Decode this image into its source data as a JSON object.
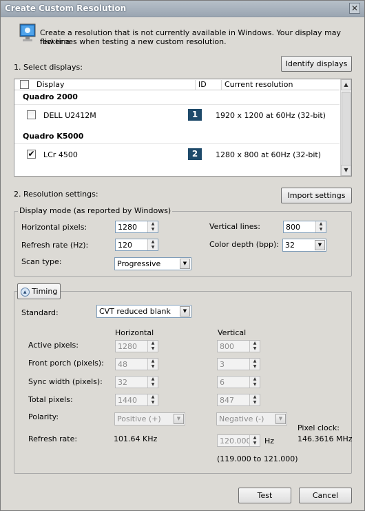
{
  "window": {
    "title": "Create Custom Resolution",
    "close_glyph": "✕"
  },
  "intro": {
    "icon": "monitor-icon",
    "text_line1": "Create a resolution that is not currently available in Windows. Your display may flicker a",
    "text_line2": "few times when testing a new custom resolution."
  },
  "select_displays": {
    "heading": "1. Select displays:",
    "identify_button": "Identify displays",
    "columns": {
      "display": "Display",
      "id": "ID",
      "resolution": "Current resolution"
    },
    "groups": [
      {
        "name": "Quadro 2000",
        "display": "DELL U2412M",
        "checked": false,
        "id": "1",
        "resolution": "1920 x 1200 at 60Hz (32-bit)"
      },
      {
        "name": "Quadro K5000",
        "display": "LCr 4500",
        "checked": true,
        "id": "2",
        "resolution": "1280 x 800 at 60Hz (32-bit)"
      }
    ],
    "scroll_up_glyph": "▲",
    "scroll_down_glyph": "▼",
    "check_glyph": "✔"
  },
  "resolution_settings": {
    "heading": "2. Resolution settings:",
    "import_button": "Import settings",
    "display_mode": {
      "legend": "Display mode (as reported by Windows)",
      "horizontal_pixels": {
        "label": "Horizontal pixels:",
        "value": "1280"
      },
      "refresh_rate": {
        "label": "Refresh rate (Hz):",
        "value": "120"
      },
      "scan_type": {
        "label": "Scan type:",
        "value": "Progressive"
      },
      "vertical_lines": {
        "label": "Vertical lines:",
        "value": "800"
      },
      "color_depth": {
        "label": "Color depth (bpp):",
        "value": "32"
      }
    },
    "timing": {
      "toggle_label": "Timing",
      "toggle_glyph": "▲",
      "standard": {
        "label": "Standard:",
        "value": "CVT reduced blank"
      },
      "col_horizontal": "Horizontal",
      "col_vertical": "Vertical",
      "rows": [
        {
          "label": "Active pixels:",
          "h": "1280",
          "v": "800"
        },
        {
          "label": "Front porch (pixels):",
          "h": "48",
          "v": "3"
        },
        {
          "label": "Sync width (pixels):",
          "h": "32",
          "v": "6"
        },
        {
          "label": "Total pixels:",
          "h": "1440",
          "v": "847"
        }
      ],
      "polarity": {
        "label": "Polarity:",
        "h": "Positive (+)",
        "v": "Negative (-)"
      },
      "refresh": {
        "label": "Refresh rate:",
        "h": "101.64 KHz",
        "v": "120.000",
        "unit": "Hz",
        "range": "(119.000 to 121.000)"
      },
      "pixel_clock": {
        "label": "Pixel clock:",
        "value": "146.3616 MHz"
      }
    }
  },
  "footer": {
    "test_button": "Test",
    "cancel_button": "Cancel"
  },
  "glyphs": {
    "spin_up": "▲",
    "spin_down": "▼",
    "dropdown": "▼"
  }
}
